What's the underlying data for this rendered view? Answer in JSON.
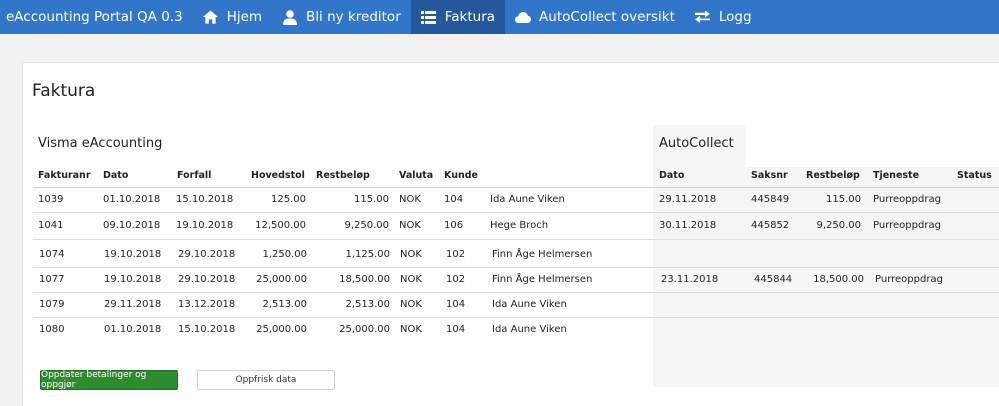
{
  "nav": {
    "brand": "eAccounting Portal QA 0.3",
    "items": [
      {
        "label": "Hjem",
        "icon": "home-icon"
      },
      {
        "label": "Bli ny kreditor",
        "icon": "user-icon"
      },
      {
        "label": "Faktura",
        "icon": "list-icon",
        "active": true
      },
      {
        "label": "AutoCollect oversikt",
        "icon": "cloud-icon"
      },
      {
        "label": "Logg",
        "icon": "transfer-icon"
      }
    ]
  },
  "page": {
    "title": "Faktura",
    "visma_title": "Visma eAccounting",
    "autocollect_title": "AutoCollect"
  },
  "table": {
    "headers": {
      "fakturanr": "Fakturanr",
      "dato": "Dato",
      "forfall": "Forfall",
      "hovedstol": "Hovedstol",
      "restbelop": "Restbeløp",
      "valuta": "Valuta",
      "kunde": "Kunde",
      "ac_dato": "Dato",
      "ac_saksnr": "Saksnr",
      "ac_restbelop": "Restbeløp",
      "ac_tjeneste": "Tjeneste",
      "ac_status": "Status"
    },
    "rows": [
      {
        "fakturanr": "1039",
        "dato": "01.10.2018",
        "forfall": "15.10.2018",
        "hovedstol": "125.00",
        "restbelop": "115.00",
        "valuta": "NOK",
        "kundenr": "104",
        "kunde": "Ida Aune Viken",
        "ac_dato": "29.11.2018",
        "ac_saksnr": "445849",
        "ac_restbelop": "115.00",
        "ac_tjeneste": "Purreoppdrag",
        "ac_status": ""
      },
      {
        "fakturanr": "1041",
        "dato": "09.10.2018",
        "forfall": "19.10.2018",
        "hovedstol": "12,500.00",
        "restbelop": "9,250.00",
        "valuta": "NOK",
        "kundenr": "106",
        "kunde": "Hege Broch",
        "ac_dato": "30.11.2018",
        "ac_saksnr": "445852",
        "ac_restbelop": "9,250.00",
        "ac_tjeneste": "Purreoppdrag",
        "ac_status": ""
      },
      {
        "fakturanr": "1074",
        "dato": "19.10.2018",
        "forfall": "29.10.2018",
        "hovedstol": "1,250.00",
        "restbelop": "1,125.00",
        "valuta": "NOK",
        "kundenr": "102",
        "kunde": "Finn Åge Helmersen",
        "ac_dato": "",
        "ac_saksnr": "",
        "ac_restbelop": "",
        "ac_tjeneste": "",
        "ac_status": ""
      },
      {
        "fakturanr": "1077",
        "dato": "19.10.2018",
        "forfall": "29.10.2018",
        "hovedstol": "25,000.00",
        "restbelop": "18,500.00",
        "valuta": "NOK",
        "kundenr": "102",
        "kunde": "Finn Åge Helmersen",
        "ac_dato": "23.11.2018",
        "ac_saksnr": "445844",
        "ac_restbelop": "18,500.00",
        "ac_tjeneste": "Purreoppdrag",
        "ac_status": ""
      },
      {
        "fakturanr": "1079",
        "dato": "29.11.2018",
        "forfall": "13.12.2018",
        "hovedstol": "2,513.00",
        "restbelop": "2,513.00",
        "valuta": "NOK",
        "kundenr": "104",
        "kunde": "Ida Aune Viken",
        "ac_dato": "",
        "ac_saksnr": "",
        "ac_restbelop": "",
        "ac_tjeneste": "",
        "ac_status": ""
      },
      {
        "fakturanr": "1080",
        "dato": "01.10.2018",
        "forfall": "15.10.2018",
        "hovedstol": "25,000.00",
        "restbelop": "25,000.00",
        "valuta": "NOK",
        "kundenr": "104",
        "kunde": "Ida Aune Viken",
        "ac_dato": "",
        "ac_saksnr": "",
        "ac_restbelop": "",
        "ac_tjeneste": "",
        "ac_status": ""
      }
    ]
  },
  "buttons": {
    "update": "Oppdater betalinger og oppgjør",
    "refresh": "Oppfrisk data"
  },
  "colors": {
    "navbar": "#3276c9",
    "nav_active": "#24589a",
    "green_button": "#2e8b2e"
  }
}
